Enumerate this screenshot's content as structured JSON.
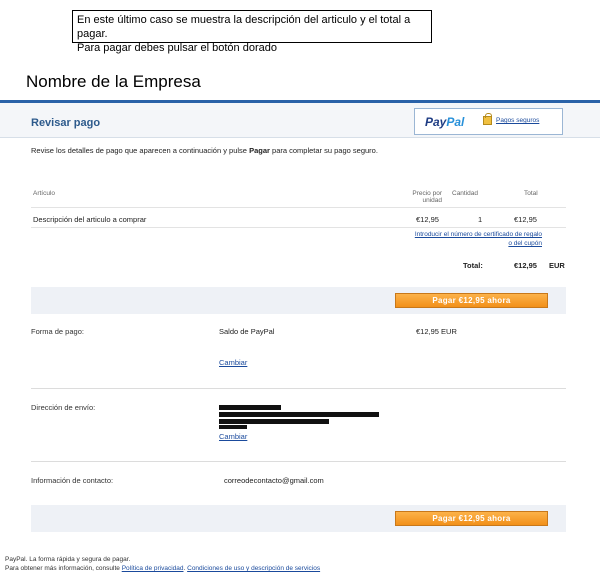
{
  "note": {
    "line1": "En este último caso se muestra la descripción del articulo y el total a pagar.",
    "line2": "Para pagar debes pulsar el botón dorado"
  },
  "company": "Nombre de la Empresa",
  "header": {
    "title": "Revisar pago",
    "paypal_logo_1": "Pay",
    "paypal_logo_2": "Pal",
    "secure_link": "Pagos seguros"
  },
  "instructions": {
    "before": "Revise los detalles de pago que aparecen a continuación y pulse ",
    "bold": "Pagar",
    "after": " para completar su pago seguro."
  },
  "table": {
    "headers": {
      "article": "Artículo",
      "price": "Precio por unidad",
      "qty": "Cantidad",
      "total": "Total"
    },
    "rows": [
      {
        "description": "Descripción del articulo a comprar",
        "price": "€12,95",
        "qty": "1",
        "total": "€12,95"
      }
    ],
    "coupon_link_1": "Introducir el número de certificado de regalo",
    "coupon_link_2": "o del cupón",
    "total_label": "Total:",
    "total_value": "€12,95",
    "currency": "EUR"
  },
  "pay_button": "Pagar €12,95 ahora",
  "payment": {
    "label": "Forma de pago:",
    "method": "Saldo de PayPal",
    "amount": "€12,95 EUR",
    "change": "Cambiar"
  },
  "shipping": {
    "label": "Dirección de envío:",
    "change": "Cambiar"
  },
  "contact": {
    "label": "Información de contacto:",
    "email": "correodecontacto@gmail.com"
  },
  "footer": {
    "line1": "PayPal. La forma rápida y segura de pagar.",
    "line2_prefix": "Para obtener más información, consulte ",
    "privacy": "Política de privacidad",
    "sep": ". ",
    "terms": "Condiciones de uso y descripción de servicios"
  },
  "colors": {
    "accent": "#2a62a8",
    "button": "#f29019",
    "band": "#eef1f6"
  }
}
